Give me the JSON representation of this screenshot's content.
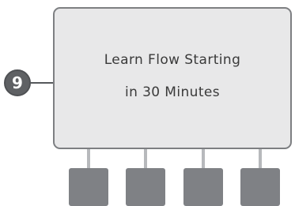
{
  "display": {
    "line1": "Learn Flow Starting",
    "line2": "in 30 Minutes"
  },
  "callout": {
    "number": "9"
  },
  "buttons": [
    {
      "name": "button-1"
    },
    {
      "name": "button-2"
    },
    {
      "name": "button-3"
    },
    {
      "name": "button-4"
    }
  ],
  "colors": {
    "screen_fill": "#e8e8e9",
    "screen_border": "#7d7f82",
    "button_fill": "#7f8185",
    "badge_fill": "#5f6164"
  }
}
